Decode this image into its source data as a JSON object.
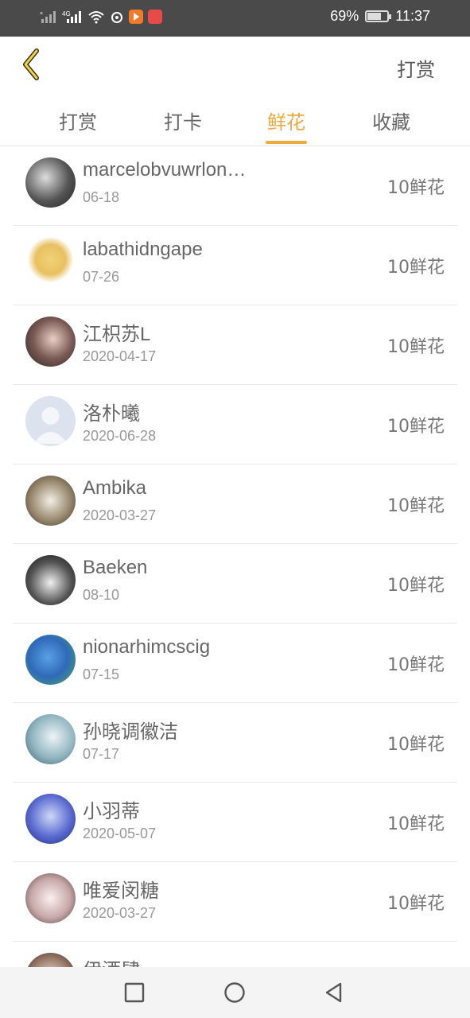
{
  "status_bar": {
    "signal_text": "4G",
    "battery": "69%",
    "battery_level": 0.69,
    "time": "11:37"
  },
  "header": {
    "back_icon": "chevron-left-icon",
    "action_label": "打赏"
  },
  "tabs": [
    {
      "label": "打赏",
      "active": false
    },
    {
      "label": "打卡",
      "active": false
    },
    {
      "label": "鲜花",
      "active": true
    },
    {
      "label": "收藏",
      "active": false
    }
  ],
  "colors": {
    "accent": "#f0a93c",
    "status_bar": "#4a4a4a"
  },
  "list": [
    {
      "name": "marcelobvuwrlon…",
      "date": "06-18",
      "amount": "10鲜花"
    },
    {
      "name": "labathidngape",
      "date": "07-26",
      "amount": "10鲜花"
    },
    {
      "name": "江枳苏L",
      "date": "2020-04-17",
      "amount": "10鲜花"
    },
    {
      "name": "洛朴曦",
      "date": "2020-06-28",
      "amount": "10鲜花"
    },
    {
      "name": "Ambika",
      "date": "2020-03-27",
      "amount": "10鲜花"
    },
    {
      "name": "Baeken",
      "date": "08-10",
      "amount": "10鲜花"
    },
    {
      "name": "nionarhimcscig",
      "date": "07-15",
      "amount": "10鲜花"
    },
    {
      "name": "孙晓调徽洁",
      "date": "07-17",
      "amount": "10鲜花"
    },
    {
      "name": "小羽蒂",
      "date": "2020-05-07",
      "amount": "10鲜花"
    },
    {
      "name": "唯爱闵糖",
      "date": "2020-03-27",
      "amount": "10鲜花"
    },
    {
      "name": "伊洒肆",
      "date": "",
      "amount": ""
    }
  ]
}
